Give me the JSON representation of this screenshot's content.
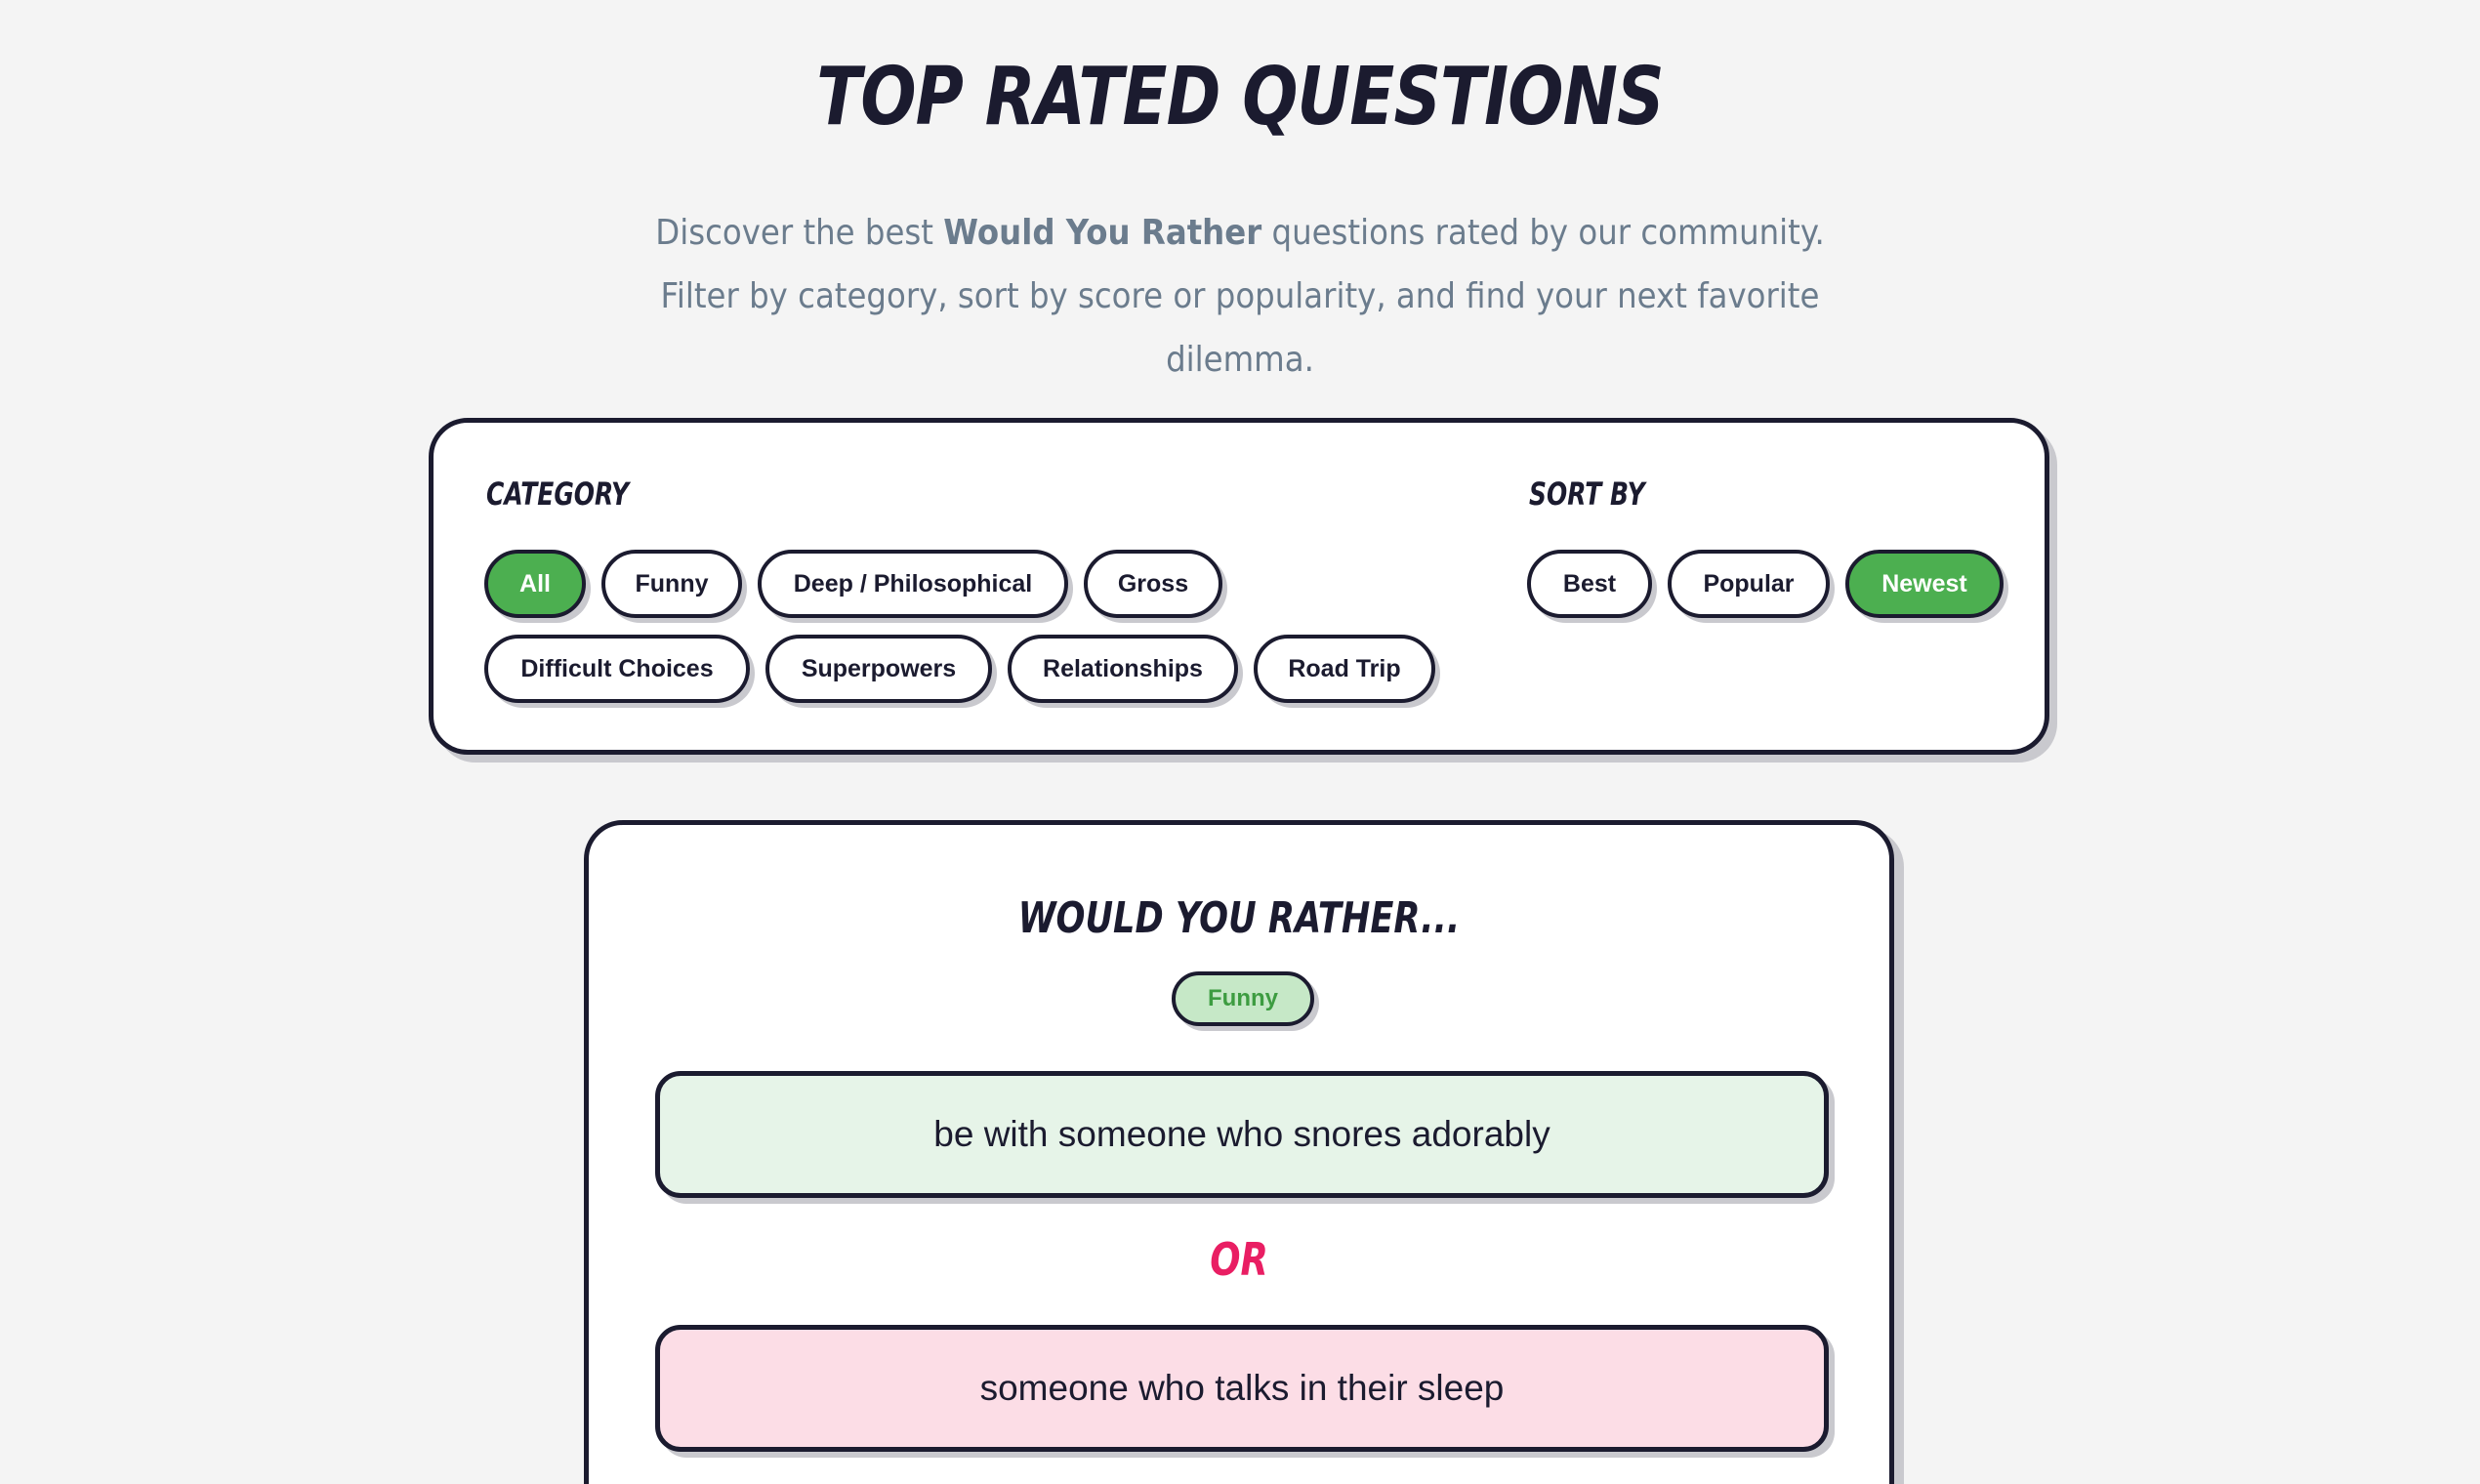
{
  "header": {
    "title": "TOP RATED QUESTIONS",
    "subtitle_before": "Discover the best ",
    "subtitle_bold": "Would You Rather",
    "subtitle_after": " questions rated by our community. Filter by category, sort by score or popularity, and find your next favorite dilemma."
  },
  "filters": {
    "category_label": "CATEGORY",
    "categories": [
      {
        "label": "All",
        "active": true
      },
      {
        "label": "Funny",
        "active": false
      },
      {
        "label": "Deep / Philosophical",
        "active": false
      },
      {
        "label": "Gross",
        "active": false
      },
      {
        "label": "Difficult Choices",
        "active": false
      },
      {
        "label": "Superpowers",
        "active": false
      },
      {
        "label": "Relationships",
        "active": false
      },
      {
        "label": "Road Trip",
        "active": false
      }
    ],
    "sort_label": "SORT BY",
    "sorts": [
      {
        "label": "Best",
        "active": false
      },
      {
        "label": "Popular",
        "active": false
      },
      {
        "label": "Newest",
        "active": true
      }
    ]
  },
  "question": {
    "heading": "WOULD YOU RATHER...",
    "category_badge": "Funny",
    "option_a": "be with someone who snores adorably",
    "or_label": "OR",
    "option_b": "someone who talks in their sleep"
  },
  "colors": {
    "accent_green": "#4caf50",
    "or_pink": "#e91e63",
    "option_a_bg": "#e6f4e8",
    "option_b_bg": "#fcdde6",
    "ink": "#1b1b2f"
  }
}
